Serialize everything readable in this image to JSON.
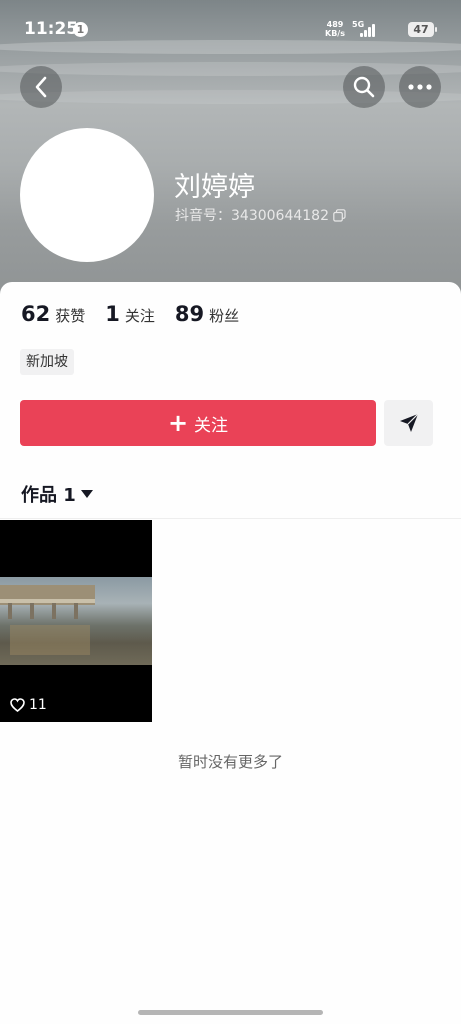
{
  "status_bar": {
    "time": "11:25",
    "notification_count": "1",
    "net_speed_value": "489",
    "net_speed_unit": "KB/s",
    "network": "5G",
    "battery": "47"
  },
  "profile": {
    "name": "刘婷婷",
    "douyin_id": "抖音号：34300644182"
  },
  "stats": [
    {
      "num": "62",
      "label": "获赞"
    },
    {
      "num": "1",
      "label": "关注"
    },
    {
      "num": "89",
      "label": "粉丝"
    }
  ],
  "tag": "新加坡",
  "actions": {
    "follow_icon": "+",
    "follow_label": "关注"
  },
  "works_tab": "作品 1",
  "video": {
    "likes": "11"
  },
  "footer_text": "暂时没有更多了",
  "icons": {
    "back": "back-arrow-icon",
    "search": "search-icon",
    "more": "more-dots-icon",
    "copy": "copy-icon",
    "share": "send-icon",
    "dropdown": "triangle-down-icon",
    "heart": "heart-icon"
  },
  "colors": {
    "accent": "#ea4257",
    "text": "#161823"
  }
}
